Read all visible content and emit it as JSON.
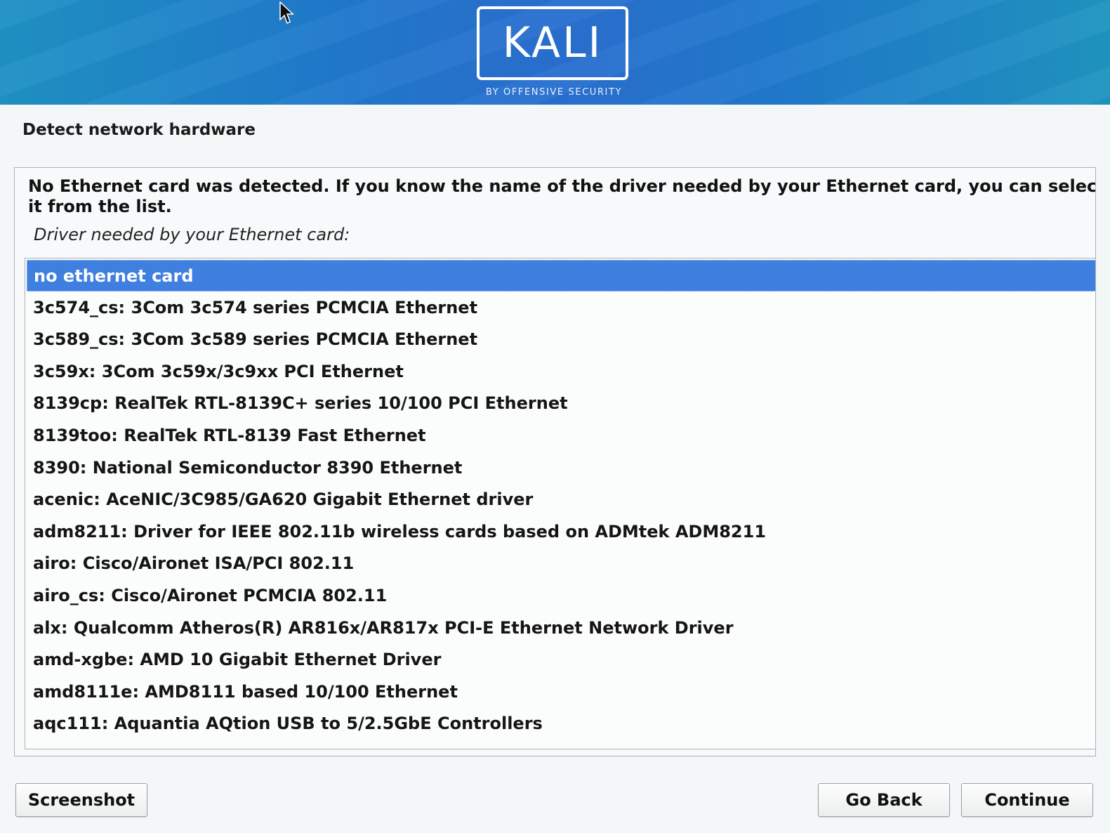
{
  "banner": {
    "logo_text": "KALI",
    "logo_subtitle": "BY OFFENSIVE SECURITY"
  },
  "step_title": "Detect network hardware",
  "message": "No Ethernet card was detected. If you know the name of the driver needed by your Ethernet card, you can select it from the list.",
  "question": "Driver needed by your Ethernet card:",
  "driver_list": {
    "selected_index": 0,
    "items": [
      "no ethernet card",
      "3c574_cs: 3Com 3c574 series PCMCIA Ethernet",
      "3c589_cs: 3Com 3c589 series PCMCIA Ethernet",
      "3c59x: 3Com 3c59x/3c9xx PCI Ethernet",
      "8139cp: RealTek RTL-8139C+ series 10/100 PCI Ethernet",
      "8139too: RealTek RTL-8139 Fast Ethernet",
      "8390: National Semiconductor 8390 Ethernet",
      "acenic: AceNIC/3C985/GA620 Gigabit Ethernet driver",
      "adm8211: Driver for IEEE 802.11b wireless cards based on ADMtek ADM8211",
      "airo: Cisco/Aironet ISA/PCI 802.11",
      "airo_cs: Cisco/Aironet PCMCIA 802.11",
      "alx: Qualcomm Atheros(R) AR816x/AR817x PCI-E Ethernet Network Driver",
      "amd-xgbe: AMD 10 Gigabit Ethernet Driver",
      "amd8111e: AMD8111 based 10/100 Ethernet",
      "aqc111: Aquantia AQtion USB to 5/2.5GbE Controllers"
    ]
  },
  "buttons": {
    "screenshot": "Screenshot",
    "go_back": "Go Back",
    "continue": "Continue"
  },
  "colors": {
    "banner_blue": "#2a6fd0",
    "selection_blue": "#3e7fe0",
    "background": "#f3f7f8"
  }
}
